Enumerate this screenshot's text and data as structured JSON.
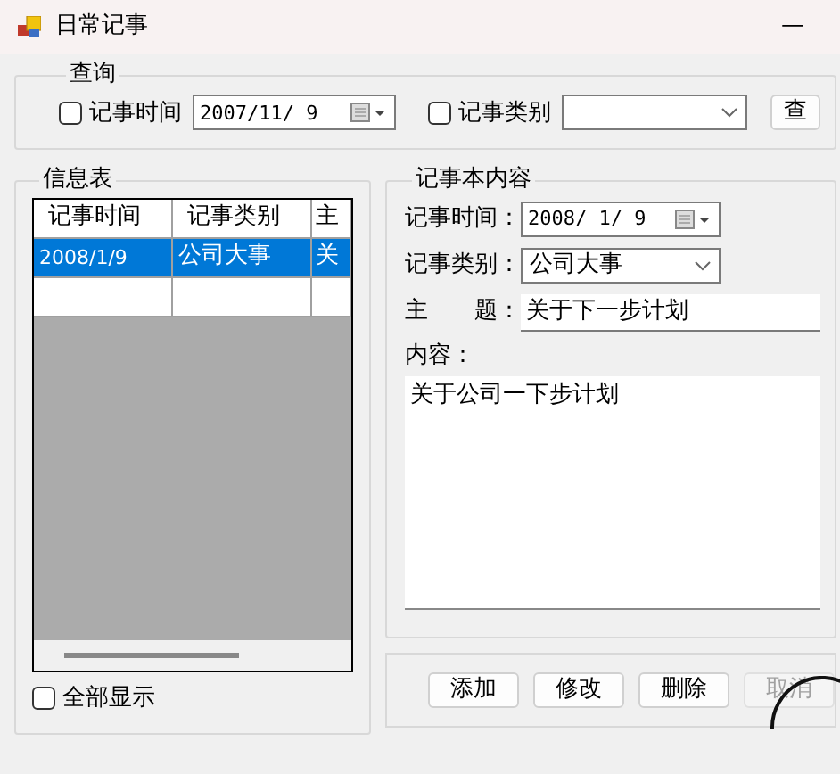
{
  "window": {
    "title": "日常记事",
    "minimize": "—"
  },
  "query": {
    "legend": "查询",
    "controls": [
      {
        "kind": "checkbox",
        "label": "记事时间",
        "checked": false
      },
      {
        "kind": "date",
        "value": "2007/11/ 9"
      },
      {
        "kind": "checkbox",
        "label": "记事类别",
        "checked": false
      },
      {
        "kind": "combo"
      },
      {
        "kind": "button",
        "label": "查"
      }
    ]
  },
  "info": {
    "legend": "信息表",
    "table": {
      "columns": [
        "记事时间",
        "记事类别",
        "主"
      ],
      "rows": [
        {
          "cells": [
            "2008/1/9",
            "公司大事",
            "关"
          ],
          "selected": true
        }
      ],
      "new_row": true
    },
    "show_all": {
      "label": "全部显示",
      "checked": false
    }
  },
  "detail": {
    "legend": "记事本内容",
    "fields": [
      {
        "kind": "date",
        "label": "记事时间：",
        "value": "2008/ 1/ 9"
      },
      {
        "kind": "combo",
        "label": "记事类别：",
        "value": "公司大事"
      },
      {
        "kind": "text",
        "label": "主　　题：",
        "value": "关于下一步计划"
      }
    ],
    "content_label": "内容：",
    "content": "关于公司一下步计划"
  },
  "buttons": [
    {
      "label": "添加",
      "disabled": false
    },
    {
      "label": "修改",
      "disabled": false
    },
    {
      "label": "删除",
      "disabled": false
    },
    {
      "label": "取消",
      "disabled": true
    }
  ]
}
